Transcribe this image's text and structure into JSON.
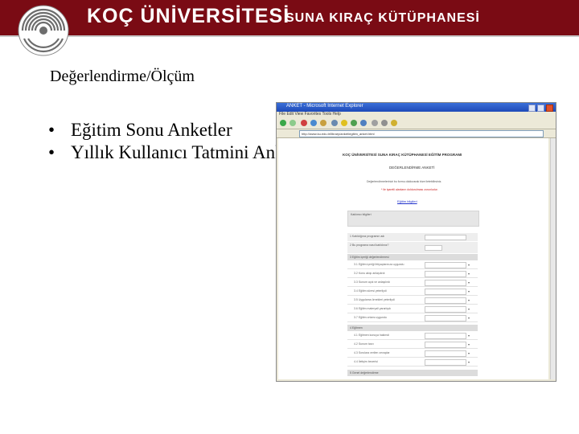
{
  "header": {
    "university": "KOÇ ÜNİVERSİTESİ",
    "library": "SUNA KIRAÇ KÜTÜPHANESİ",
    "brand_color": "#7a0b14"
  },
  "slide": {
    "title": "Değerlendirme/Ölçüm",
    "bullets": [
      "Eğitim Sonu Anketler",
      "Yıllık Kullanıcı Tatmini Anketi"
    ]
  },
  "screenshot": {
    "window_title": "ANKET - Microsoft Internet Explorer",
    "menu": "File  Edit  View  Favorites  Tools  Help",
    "address": "http://www.ku.edu.tr/library/anket/egitim_anket.html",
    "form_title": "KOÇ ÜNİVERSİTESİ SUNA KIRAÇ KÜTÜPHANESİ EĞİTİM PROGRAMI",
    "form_subtitle": "DEĞERLENDİRME ANKETİ",
    "form_note": "Değerlendirmelerinizi bu formu doldurarak bize iletebilirsiniz.",
    "form_required": "* ile işaretli alanların doldurulması zorunludur.",
    "form_link": "Eğitim bilgileri",
    "section_participant": "Katılımcı bilgileri",
    "q1": "1 Katıldığınız programın adı",
    "q2": "2 Bu programa nasıl katıldınız?",
    "q3": "3 Eğitim içeriği değerlendirmesi",
    "q4": "4 Eğitmen",
    "q5": "5 Genel değerlendirme",
    "items_3": [
      "3.1 Eğitim içeriği ihtiyaçlarınıza uygundu",
      "3.2 Konu akışı anlaşılırdı",
      "3.3 Sunum açık ve anlaşılırdı",
      "3.4 Eğitim süresi yeterliydi",
      "3.5 Uygulama örnekleri yeterliydi",
      "3.6 Eğitim materyali yararlıydı",
      "3.7 Eğitim ortamı uygundu"
    ],
    "items_4": [
      "4.1 Eğitmen konuya hakimdi",
      "4.2 Sunum tarzı",
      "4.3 Sorulara verilen cevaplar",
      "4.4 İletişim becerisi"
    ]
  }
}
